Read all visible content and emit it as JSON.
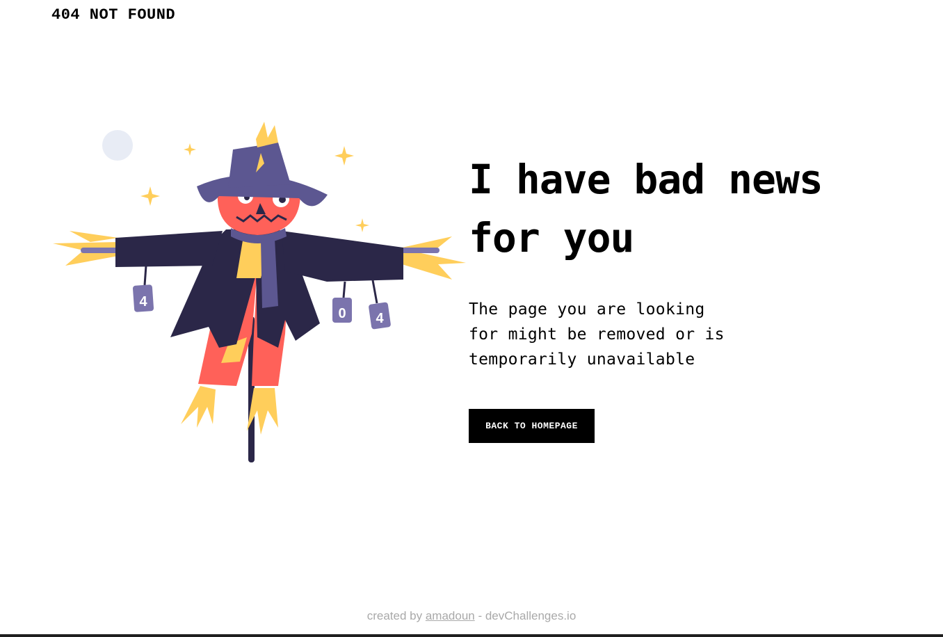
{
  "header": {
    "brand": "404 NOT FOUND"
  },
  "main": {
    "headline_line1": "I have bad news",
    "headline_line2": "for you",
    "description_line1": "The page you are looking",
    "description_line2": "for might be removed or is",
    "description_line3": "temporarily unavailable",
    "button_label": "BACK TO HOMEPAGE"
  },
  "illustration": {
    "subject": "scarecrow",
    "can_labels": [
      "4",
      "0",
      "4"
    ],
    "colors": {
      "hat": "#5C5791",
      "coat": "#2B2748",
      "face": "#FF6159",
      "straw": "#FFCE5B",
      "scarf": "#5C5791",
      "pole": "#2B2748",
      "moon": "#E8ECF5",
      "can": "#7B74AD"
    }
  },
  "footer": {
    "prefix": "created by",
    "author": "amadoun",
    "suffix": "- devChallenges.io"
  },
  "colors": {
    "background": "#FFFFFF",
    "text": "#000000",
    "button_bg": "#000000",
    "button_text": "#FFFFFF",
    "footer_text": "#A9A9A9"
  }
}
